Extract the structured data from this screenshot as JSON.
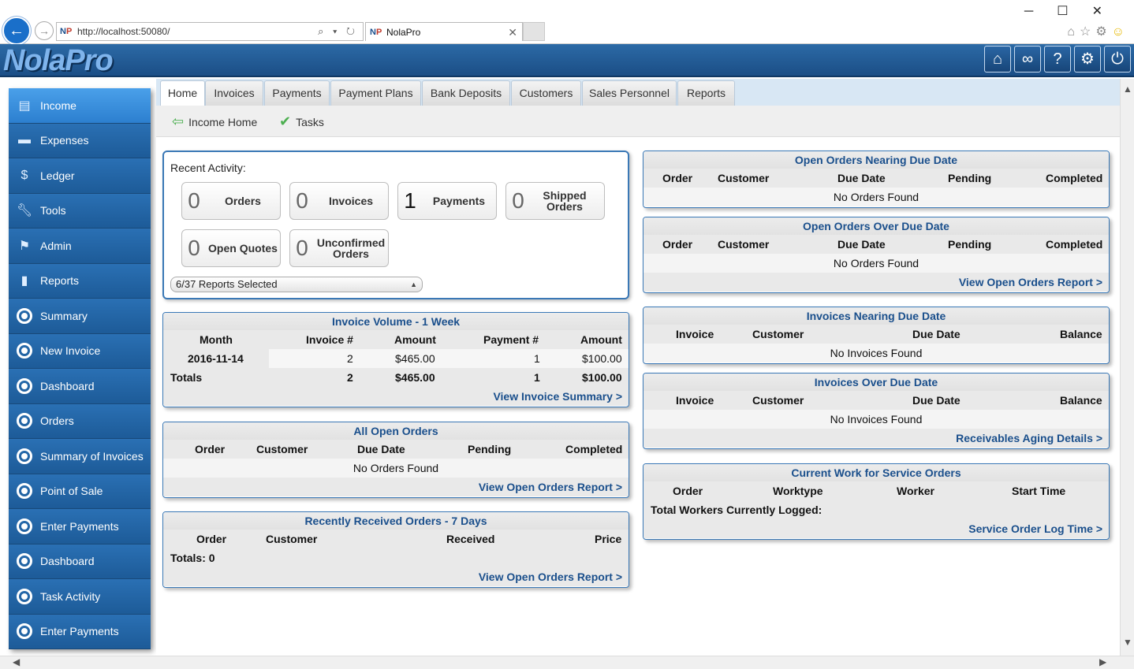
{
  "browser": {
    "url": "http://localhost:50080/",
    "addr_icons": "⌕ ▾ ↻",
    "tab_title": "NolaPro",
    "tab_favicon": "NP",
    "controls": [
      "─",
      "☐",
      "✕"
    ]
  },
  "app": {
    "logo": "NolaPro",
    "header_buttons": [
      "home-icon",
      "link-icon",
      "help-icon",
      "gear-icon",
      "power-icon"
    ]
  },
  "sidebar": {
    "items": [
      {
        "label": "Income",
        "icon": "document-icon"
      },
      {
        "label": "Expenses",
        "icon": "money-icon"
      },
      {
        "label": "Ledger",
        "icon": "coin-icon"
      },
      {
        "label": "Tools",
        "icon": "wrench-icon"
      },
      {
        "label": "Admin",
        "icon": "flag-icon"
      },
      {
        "label": "Reports",
        "icon": "bar-chart-icon"
      },
      {
        "label": "Summary",
        "icon": "circle-icon"
      },
      {
        "label": "New Invoice",
        "icon": "circle-icon"
      },
      {
        "label": "Dashboard",
        "icon": "circle-icon"
      },
      {
        "label": "Orders",
        "icon": "circle-icon"
      },
      {
        "label": "Summary of Invoices",
        "icon": "circle-icon"
      },
      {
        "label": "Point of Sale",
        "icon": "circle-icon"
      },
      {
        "label": "Enter Payments",
        "icon": "circle-icon"
      },
      {
        "label": "Dashboard",
        "icon": "circle-icon"
      },
      {
        "label": "Task Activity",
        "icon": "circle-icon"
      },
      {
        "label": "Enter Payments",
        "icon": "circle-icon"
      }
    ]
  },
  "tabs": [
    "Home",
    "Invoices",
    "Payments",
    "Payment Plans",
    "Bank Deposits",
    "Customers",
    "Sales Personnel",
    "Reports"
  ],
  "subnav": [
    "Income Home",
    "Tasks"
  ],
  "recent": {
    "label": "Recent Activity:",
    "boxes": [
      {
        "num": "0",
        "label": "Orders"
      },
      {
        "num": "0",
        "label": "Invoices"
      },
      {
        "num": "1",
        "label": "Payments"
      },
      {
        "num": "0",
        "label": "Shipped Orders"
      },
      {
        "num": "0",
        "label": "Open Quotes"
      },
      {
        "num": "0",
        "label": "Unconfirmed Orders"
      }
    ],
    "select": "6/37 Reports Selected"
  },
  "invoice_volume": {
    "title": "Invoice Volume - 1 Week",
    "headers": [
      "Month",
      "Invoice #",
      "Amount",
      "Payment #",
      "Amount"
    ],
    "row": [
      "2016-11-14",
      "2",
      "$465.00",
      "1",
      "$100.00"
    ],
    "totals": [
      "Totals",
      "2",
      "$465.00",
      "1",
      "$100.00"
    ],
    "link": "View Invoice Summary >"
  },
  "all_open_orders": {
    "title": "All Open Orders",
    "headers": [
      "Order",
      "Customer",
      "Due Date",
      "Pending",
      "Completed"
    ],
    "empty": "No Orders Found",
    "link": "View Open Orders Report >"
  },
  "recent_orders": {
    "title": "Recently Received Orders - 7 Days",
    "headers": [
      "Order",
      "Customer",
      "Received",
      "Price"
    ],
    "totals": "Totals: 0",
    "link": "View Open Orders Report >"
  },
  "open_near_due": {
    "title": "Open Orders Nearing Due Date",
    "headers": [
      "Order",
      "Customer",
      "Due Date",
      "Pending",
      "Completed"
    ],
    "empty": "No Orders Found"
  },
  "open_over_due": {
    "title": "Open Orders Over Due Date",
    "headers": [
      "Order",
      "Customer",
      "Due Date",
      "Pending",
      "Completed"
    ],
    "empty": "No Orders Found",
    "link": "View Open Orders Report >"
  },
  "inv_near_due": {
    "title": "Invoices Nearing Due Date",
    "headers": [
      "Invoice",
      "Customer",
      "Due Date",
      "Balance"
    ],
    "empty": "No Invoices Found"
  },
  "inv_over_due": {
    "title": "Invoices Over Due Date",
    "headers": [
      "Invoice",
      "Customer",
      "Due Date",
      "Balance"
    ],
    "empty": "No Invoices Found",
    "link": "Receivables Aging Details >"
  },
  "service_orders": {
    "title": "Current Work for Service Orders",
    "headers": [
      "Order",
      "Worktype",
      "Worker",
      "Start Time"
    ],
    "total": "Total Workers Currently Logged:",
    "link": "Service Order Log Time >"
  }
}
